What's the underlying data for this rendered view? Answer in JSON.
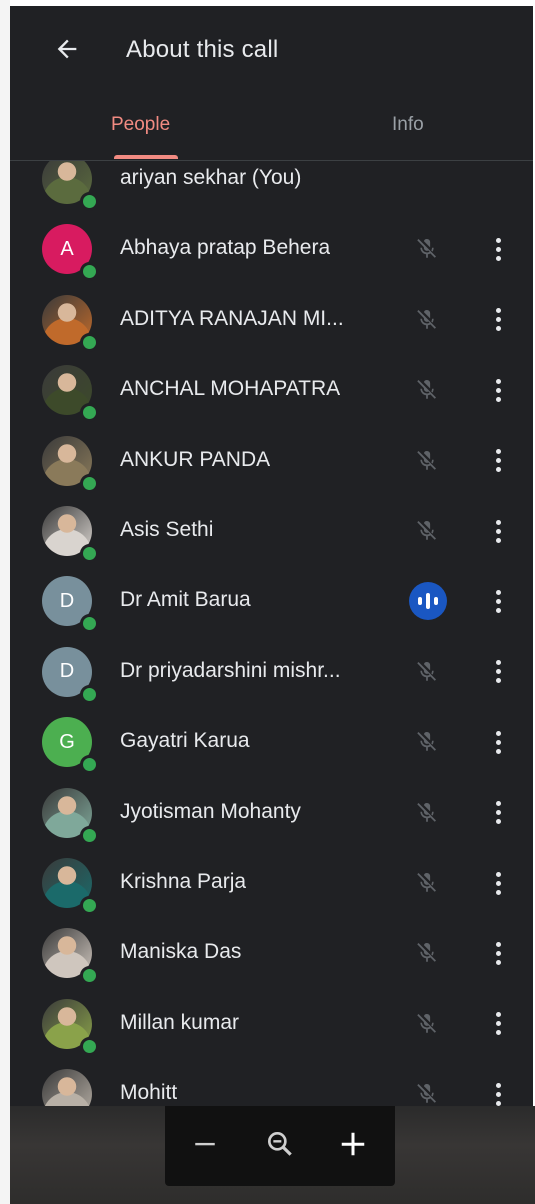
{
  "header": {
    "title": "About this call",
    "back_icon": "arrow-back-icon"
  },
  "tabs": [
    {
      "label": "People",
      "active": true
    },
    {
      "label": "Info",
      "active": false
    }
  ],
  "colors": {
    "background": "#202124",
    "accent": "#f28b82",
    "online": "#34a853",
    "speaking": "#1a57c2"
  },
  "participants": [
    {
      "name": "ariyan sekhar (You)",
      "avatar": "photo",
      "initial": "",
      "avatar_color": "#5b6b3e",
      "mic": "none"
    },
    {
      "name": "Abhaya pratap Behera",
      "avatar": "letter",
      "initial": "A",
      "avatar_color": "#d81b60",
      "mic": "muted"
    },
    {
      "name": "ADITYA RANAJAN MI...",
      "avatar": "photo",
      "initial": "",
      "avatar_color": "#c06a2b",
      "mic": "muted"
    },
    {
      "name": "ANCHAL MOHAPATRA",
      "avatar": "photo",
      "initial": "",
      "avatar_color": "#3d4a2a",
      "mic": "muted"
    },
    {
      "name": "ANKUR PANDA",
      "avatar": "photo",
      "initial": "",
      "avatar_color": "#8a7a5a",
      "mic": "muted"
    },
    {
      "name": "Asis Sethi",
      "avatar": "photo",
      "initial": "",
      "avatar_color": "#d9d4cf",
      "mic": "muted"
    },
    {
      "name": "Dr Amit Barua",
      "avatar": "letter",
      "initial": "D",
      "avatar_color": "#78909c",
      "mic": "speaking"
    },
    {
      "name": "Dr priyadarshini mishr...",
      "avatar": "letter",
      "initial": "D",
      "avatar_color": "#78909c",
      "mic": "muted"
    },
    {
      "name": "Gayatri Karua",
      "avatar": "letter",
      "initial": "G",
      "avatar_color": "#4caf50",
      "mic": "muted"
    },
    {
      "name": "Jyotisman Mohanty",
      "avatar": "photo",
      "initial": "",
      "avatar_color": "#7fa89a",
      "mic": "muted"
    },
    {
      "name": "Krishna Parja",
      "avatar": "photo",
      "initial": "",
      "avatar_color": "#1b6a6a",
      "mic": "muted"
    },
    {
      "name": "Maniska Das",
      "avatar": "photo",
      "initial": "",
      "avatar_color": "#cfc6be",
      "mic": "muted"
    },
    {
      "name": "Millan kumar",
      "avatar": "photo",
      "initial": "",
      "avatar_color": "#8aa24a",
      "mic": "muted"
    },
    {
      "name": "Mohitt",
      "avatar": "photo",
      "initial": "",
      "avatar_color": "#b8b0a6",
      "mic": "muted"
    }
  ],
  "zoom_controls": {
    "zoom_out": "minus-icon",
    "reset": "zoom-search-icon",
    "zoom_in": "plus-icon"
  }
}
